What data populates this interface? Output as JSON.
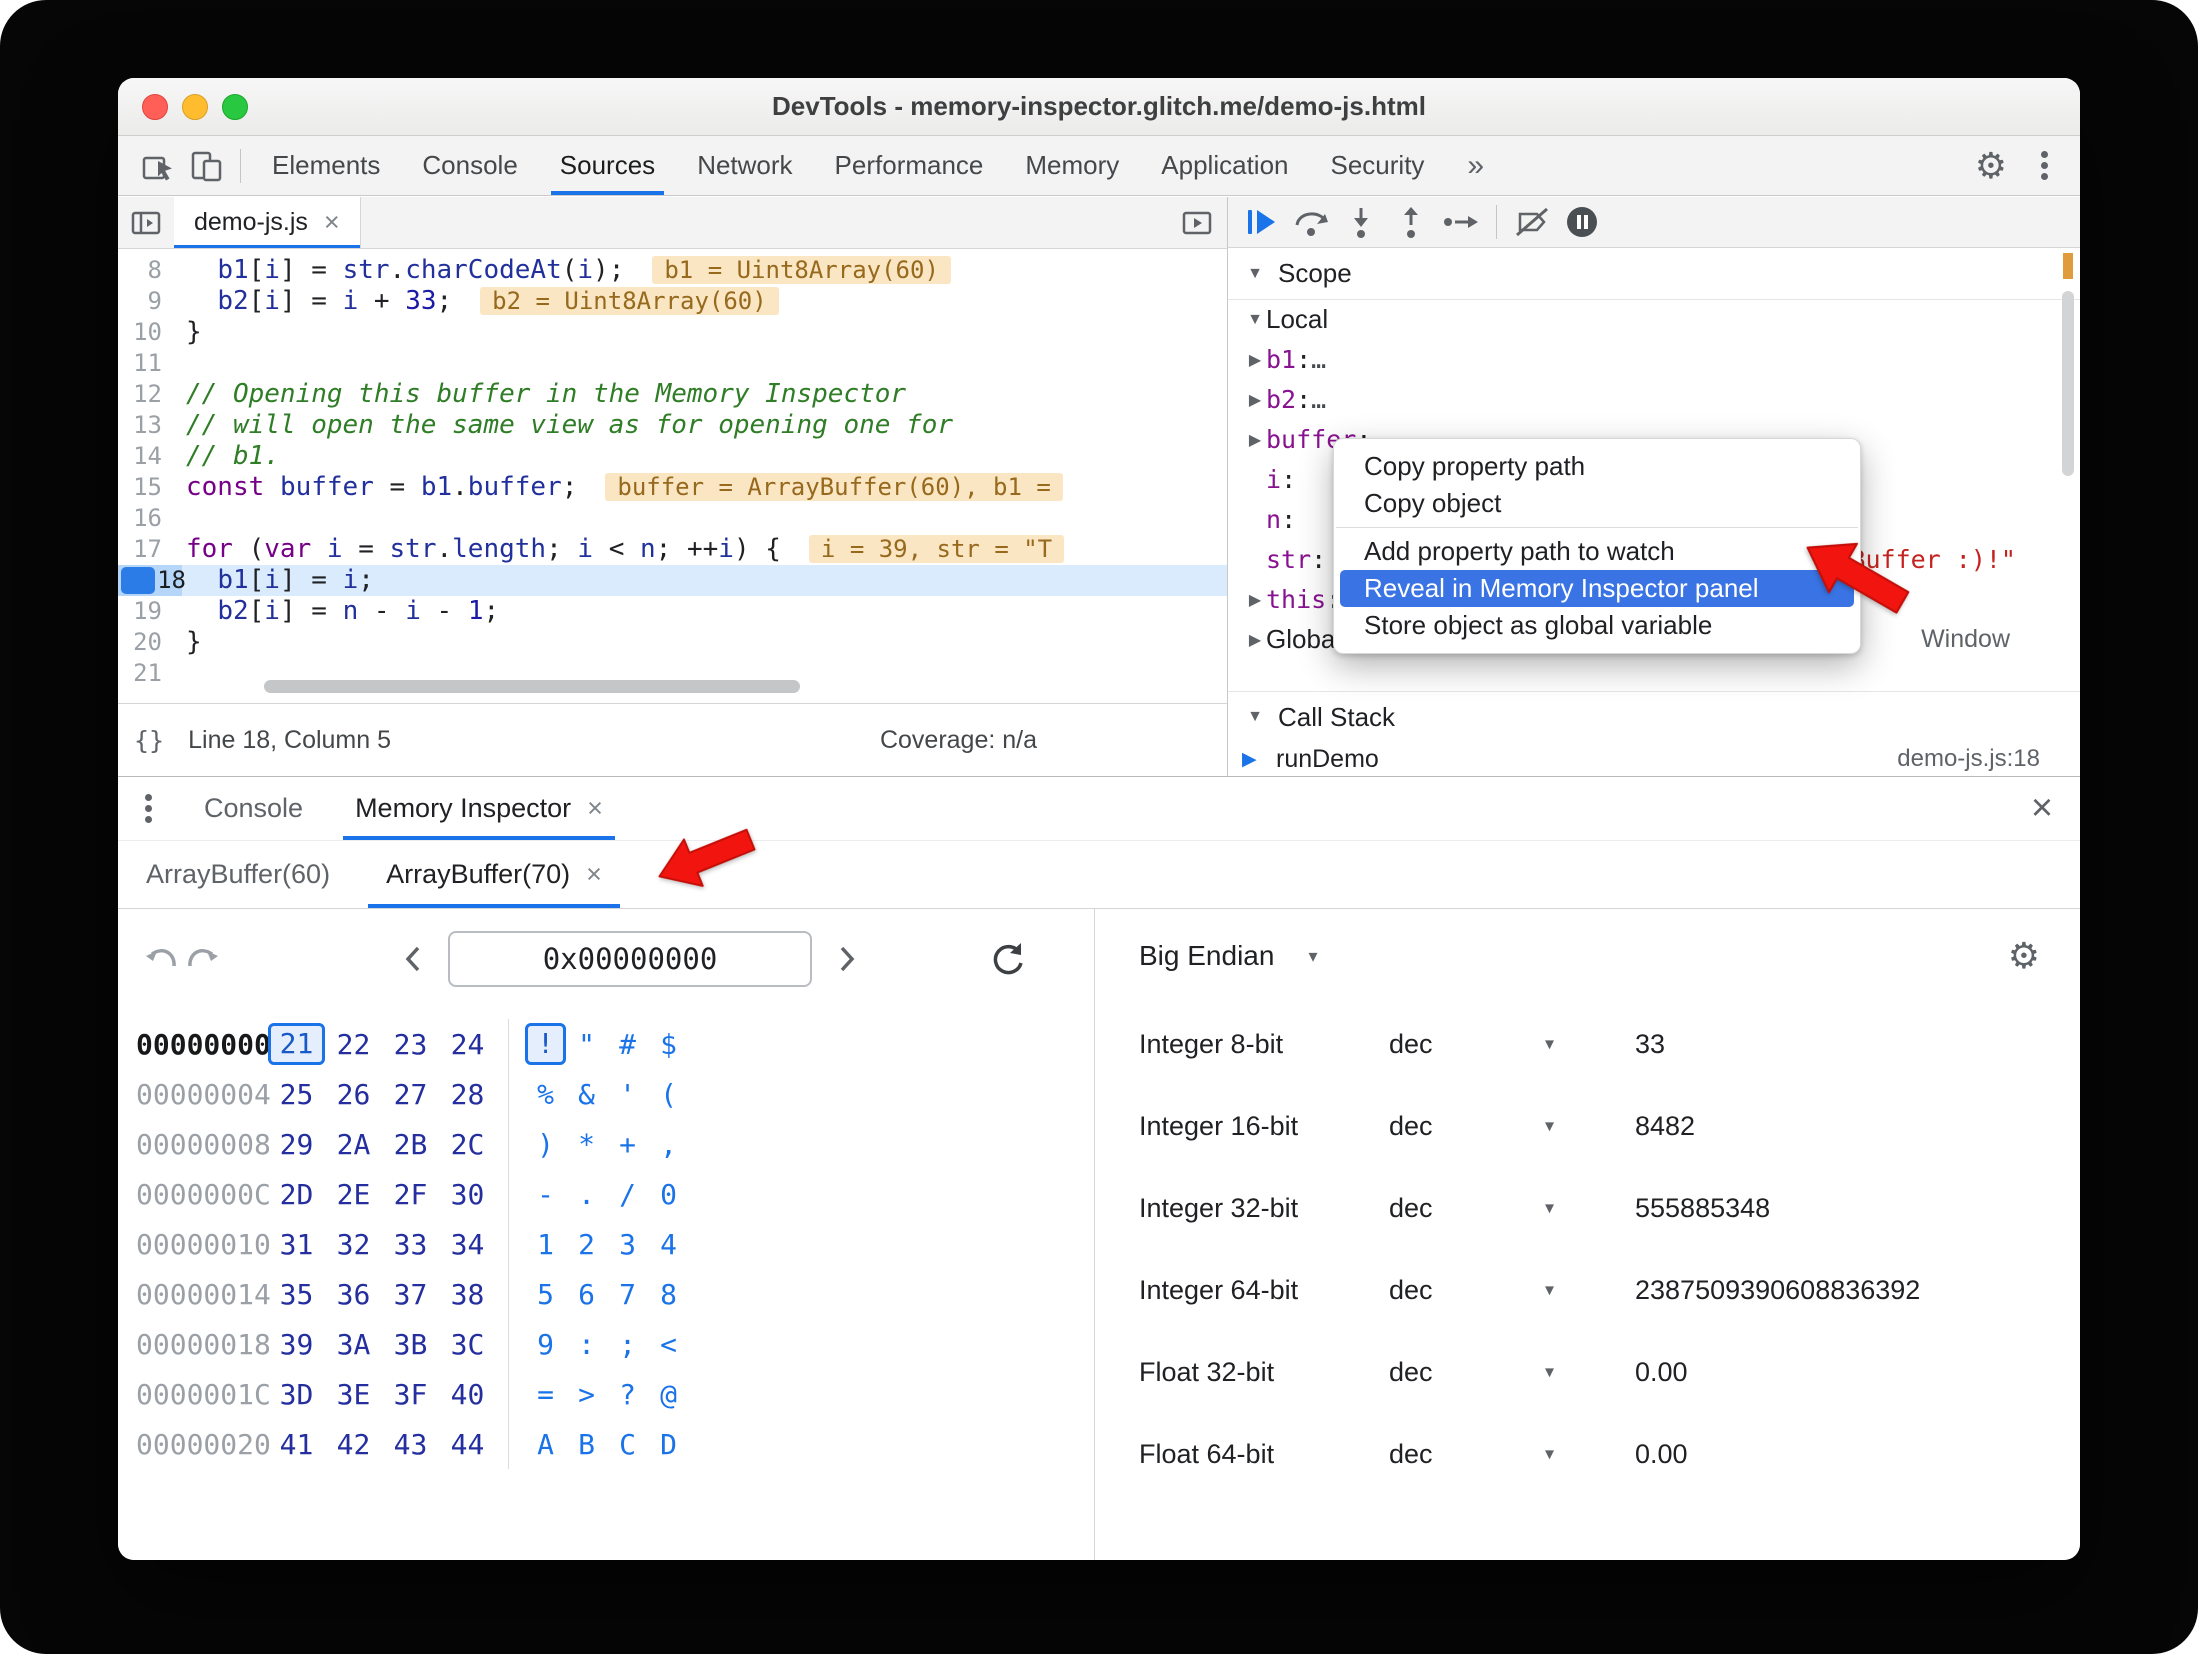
{
  "glyphs": {
    "close": "×",
    "caret": "▾",
    "tri_down": "▼",
    "tri_right": "▶",
    "overflow": "»",
    "gear": "⚙",
    "braces": "{}",
    "ellipsis": "…"
  },
  "window": {
    "title": "DevTools - memory-inspector.glitch.me/demo-js.html"
  },
  "toolbar": {
    "tabs": [
      "Elements",
      "Console",
      "Sources",
      "Network",
      "Performance",
      "Memory",
      "Application",
      "Security"
    ],
    "active_tab": "Sources",
    "overflow_label": "»"
  },
  "sources": {
    "file_tab": {
      "label": "demo-js.js"
    },
    "status": {
      "line_col": "Line 18, Column 5",
      "coverage": "Coverage: n/a"
    },
    "editor": {
      "lines": [
        {
          "num": "8",
          "tokens": [
            {
              "t": "  "
            },
            {
              "t": "b1",
              "c": "v"
            },
            {
              "t": "["
            },
            {
              "t": "i",
              "c": "v"
            },
            {
              "t": "] = "
            },
            {
              "t": "str",
              "c": "v"
            },
            {
              "t": "."
            },
            {
              "t": "charCodeAt",
              "c": "v"
            },
            {
              "t": "("
            },
            {
              "t": "i",
              "c": "v"
            },
            {
              "t": ");"
            }
          ],
          "chip": "b1 = Uint8Array(60)"
        },
        {
          "num": "9",
          "tokens": [
            {
              "t": "  "
            },
            {
              "t": "b2",
              "c": "v"
            },
            {
              "t": "["
            },
            {
              "t": "i",
              "c": "v"
            },
            {
              "t": "] = "
            },
            {
              "t": "i",
              "c": "v"
            },
            {
              "t": " + "
            },
            {
              "t": "33",
              "c": "n"
            },
            {
              "t": ";"
            }
          ],
          "chip": "b2 = Uint8Array(60)"
        },
        {
          "num": "10",
          "tokens": [
            {
              "t": "}"
            }
          ]
        },
        {
          "num": "11",
          "tokens": []
        },
        {
          "num": "12",
          "tokens": [
            {
              "t": "// Opening this buffer in the Memory Inspector",
              "c": "c"
            }
          ]
        },
        {
          "num": "13",
          "tokens": [
            {
              "t": "// will open the same view as for opening one for",
              "c": "c"
            }
          ]
        },
        {
          "num": "14",
          "tokens": [
            {
              "t": "// b1.",
              "c": "c"
            }
          ]
        },
        {
          "num": "15",
          "tokens": [
            {
              "t": "const",
              "c": "k"
            },
            {
              "t": " "
            },
            {
              "t": "buffer",
              "c": "v"
            },
            {
              "t": " = "
            },
            {
              "t": "b1",
              "c": "v"
            },
            {
              "t": "."
            },
            {
              "t": "buffer",
              "c": "v"
            },
            {
              "t": ";"
            }
          ],
          "chip": "buffer = ArrayBuffer(60), b1 ="
        },
        {
          "num": "16",
          "tokens": []
        },
        {
          "num": "17",
          "tokens": [
            {
              "t": "for",
              "c": "k"
            },
            {
              "t": " ("
            },
            {
              "t": "var",
              "c": "k"
            },
            {
              "t": " "
            },
            {
              "t": "i",
              "c": "v"
            },
            {
              "t": " = "
            },
            {
              "t": "str",
              "c": "v"
            },
            {
              "t": "."
            },
            {
              "t": "length",
              "c": "v"
            },
            {
              "t": "; "
            },
            {
              "t": "i",
              "c": "v"
            },
            {
              "t": " < "
            },
            {
              "t": "n",
              "c": "v"
            },
            {
              "t": "; ++"
            },
            {
              "t": "i",
              "c": "v"
            },
            {
              "t": ") {"
            }
          ],
          "chip": "i = 39, str = \"T"
        },
        {
          "num": "18",
          "current": true,
          "tokens": [
            {
              "t": "  "
            },
            {
              "t": "b1",
              "c": "v"
            },
            {
              "t": "["
            },
            {
              "t": "i",
              "c": "v"
            },
            {
              "t": "] = "
            },
            {
              "t": "i",
              "c": "v"
            },
            {
              "t": ";"
            }
          ]
        },
        {
          "num": "19",
          "tokens": [
            {
              "t": "  "
            },
            {
              "t": "b2",
              "c": "v"
            },
            {
              "t": "["
            },
            {
              "t": "i",
              "c": "v"
            },
            {
              "t": "] = "
            },
            {
              "t": "n",
              "c": "v"
            },
            {
              "t": " - "
            },
            {
              "t": "i",
              "c": "v"
            },
            {
              "t": " - "
            },
            {
              "t": "1",
              "c": "n"
            },
            {
              "t": ";"
            }
          ]
        },
        {
          "num": "20",
          "tokens": [
            {
              "t": "}"
            }
          ]
        },
        {
          "num": "21",
          "tokens": []
        }
      ]
    }
  },
  "debugger": {
    "sections": {
      "scope": "Scope",
      "call_stack": "Call Stack"
    },
    "scope": {
      "rows": [
        {
          "kind": "header",
          "tri": "▼",
          "label": "Local"
        },
        {
          "kind": "entry",
          "tri": "▶",
          "name": "b1",
          "value": "…"
        },
        {
          "kind": "entry",
          "tri": "▶",
          "name": "b2",
          "value": "…"
        },
        {
          "kind": "entry",
          "tri": "▶",
          "name": "buffer",
          "value": ""
        },
        {
          "kind": "entry",
          "tri": "",
          "name": "i",
          "value": ""
        },
        {
          "kind": "entry",
          "tri": "",
          "name": "n",
          "value": ""
        },
        {
          "kind": "entry",
          "tri": "",
          "name": "str",
          "value": "",
          "tail": "Buffer :)!\""
        },
        {
          "kind": "entry",
          "tri": "▶",
          "name": "this",
          "value": ""
        },
        {
          "kind": "header",
          "tri": "▶",
          "label": "Global",
          "value": "Window"
        }
      ]
    },
    "call_stack": {
      "frame": "runDemo",
      "location": "demo-js.js:18"
    }
  },
  "context_menu": {
    "items": [
      {
        "label": "Copy property path"
      },
      {
        "label": "Copy object"
      },
      {
        "divider": true
      },
      {
        "label": "Add property path to watch"
      },
      {
        "label": "Reveal in Memory Inspector panel",
        "highlighted": true
      },
      {
        "label": "Store object as global variable"
      }
    ]
  },
  "drawer": {
    "tabs": [
      {
        "label": "Console"
      },
      {
        "label": "Memory Inspector",
        "active": true,
        "closable": true
      }
    ]
  },
  "memory_inspector": {
    "tabs": [
      {
        "label": "ArrayBuffer(60)"
      },
      {
        "label": "ArrayBuffer(70)",
        "active": true,
        "closable": true
      }
    ],
    "address": "0x00000000",
    "hex_rows": [
      {
        "addr": "00000000",
        "bytes": [
          "21",
          "22",
          "23",
          "24"
        ],
        "ascii": [
          "!",
          "\"",
          "#",
          "$"
        ],
        "selected": 0
      },
      {
        "addr": "00000004",
        "bytes": [
          "25",
          "26",
          "27",
          "28"
        ],
        "ascii": [
          "%",
          "&",
          "'",
          "("
        ]
      },
      {
        "addr": "00000008",
        "bytes": [
          "29",
          "2A",
          "2B",
          "2C"
        ],
        "ascii": [
          ")",
          "*",
          "+",
          ","
        ]
      },
      {
        "addr": "0000000C",
        "bytes": [
          "2D",
          "2E",
          "2F",
          "30"
        ],
        "ascii": [
          "-",
          ".",
          "/",
          "0"
        ]
      },
      {
        "addr": "00000010",
        "bytes": [
          "31",
          "32",
          "33",
          "34"
        ],
        "ascii": [
          "1",
          "2",
          "3",
          "4"
        ]
      },
      {
        "addr": "00000014",
        "bytes": [
          "35",
          "36",
          "37",
          "38"
        ],
        "ascii": [
          "5",
          "6",
          "7",
          "8"
        ]
      },
      {
        "addr": "00000018",
        "bytes": [
          "39",
          "3A",
          "3B",
          "3C"
        ],
        "ascii": [
          "9",
          ":",
          ";",
          "<"
        ]
      },
      {
        "addr": "0000001C",
        "bytes": [
          "3D",
          "3E",
          "3F",
          "40"
        ],
        "ascii": [
          "=",
          ">",
          "?",
          "@"
        ]
      },
      {
        "addr": "00000020",
        "bytes": [
          "41",
          "42",
          "43",
          "44"
        ],
        "ascii": [
          "A",
          "B",
          "C",
          "D"
        ]
      }
    ],
    "value_inspector": {
      "endianness": "Big Endian",
      "rows": [
        {
          "label": "Integer 8-bit",
          "format": "dec",
          "value": "33"
        },
        {
          "label": "Integer 16-bit",
          "format": "dec",
          "value": "8482"
        },
        {
          "label": "Integer 32-bit",
          "format": "dec",
          "value": "555885348"
        },
        {
          "label": "Integer 64-bit",
          "format": "dec",
          "value": "2387509390608836392"
        },
        {
          "label": "Float 32-bit",
          "format": "dec",
          "value": "0.00"
        },
        {
          "label": "Float 64-bit",
          "format": "dec",
          "value": "0.00"
        }
      ]
    }
  }
}
